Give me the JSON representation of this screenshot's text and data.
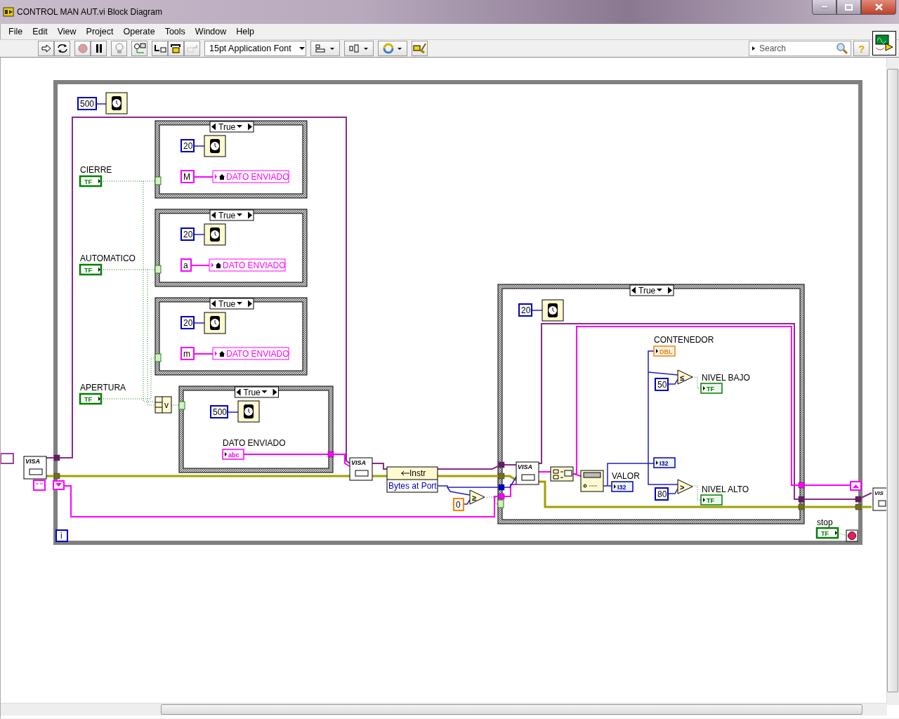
{
  "window": {
    "title": "CONTROL MAN AUT.vi Block Diagram"
  },
  "menu": [
    "File",
    "Edit",
    "View",
    "Project",
    "Operate",
    "Tools",
    "Window",
    "Help"
  ],
  "toolbar": {
    "font": "15pt Application Font",
    "search": {
      "placeholder": "Search"
    },
    "help": "?"
  },
  "nodes": [
    {
      "kind": "constant",
      "text": "500",
      "color": "#0000c0"
    },
    {
      "kind": "case",
      "selector": "True"
    },
    {
      "kind": "constant",
      "text": "20",
      "color": "#0000c0"
    },
    {
      "kind": "label",
      "text": "CIERRE"
    },
    {
      "kind": "control",
      "text": "TF",
      "color": "#008000"
    },
    {
      "kind": "constant",
      "text": "M",
      "color": "#ff00ff"
    },
    {
      "kind": "local",
      "text": "DATO ENVIADO"
    },
    {
      "kind": "case",
      "selector": "True"
    },
    {
      "kind": "constant",
      "text": "20",
      "color": "#0000c0"
    },
    {
      "kind": "label",
      "text": "AUTOMATICO"
    },
    {
      "kind": "control",
      "text": "TF",
      "color": "#008000"
    },
    {
      "kind": "constant",
      "text": "a",
      "color": "#ff00ff"
    },
    {
      "kind": "local",
      "text": "DATO ENVIADO"
    },
    {
      "kind": "case",
      "selector": "True"
    },
    {
      "kind": "constant",
      "text": "20",
      "color": "#0000c0"
    },
    {
      "kind": "constant",
      "text": "m",
      "color": "#ff00ff"
    },
    {
      "kind": "local",
      "text": "DATO ENVIADO"
    },
    {
      "kind": "case",
      "selector": "True"
    },
    {
      "kind": "label",
      "text": "APERTURA"
    },
    {
      "kind": "control",
      "text": "TF",
      "color": "#008000"
    },
    {
      "kind": "function",
      "text": "v"
    },
    {
      "kind": "constant",
      "text": "500",
      "color": "#0000c0"
    },
    {
      "kind": "label",
      "text": "DATO ENVIADO"
    },
    {
      "kind": "indicator",
      "text": "abc",
      "color": "#ff00ff"
    },
    {
      "kind": "vi",
      "text": "VISA"
    },
    {
      "kind": "vi",
      "text": "VISA"
    },
    {
      "kind": "property",
      "rows": [
        "Instr",
        "Bytes at Port"
      ]
    },
    {
      "kind": "constant",
      "text": "0",
      "color": "#ff8000"
    },
    {
      "kind": "compare",
      "text": "≥"
    },
    {
      "kind": "iteration",
      "text": "i"
    },
    {
      "kind": "case",
      "selector": "True"
    },
    {
      "kind": "constant",
      "text": "20",
      "color": "#0000c0"
    },
    {
      "kind": "label",
      "text": "CONTENEDOR"
    },
    {
      "kind": "indicator",
      "text": "DBL",
      "color": "#ff8000"
    },
    {
      "kind": "compare",
      "text": "≤"
    },
    {
      "kind": "label",
      "text": "NIVEL BAJO"
    },
    {
      "kind": "constant",
      "text": "50",
      "color": "#0000c0"
    },
    {
      "kind": "indicator",
      "text": "TF",
      "color": "#008000"
    },
    {
      "kind": "indicator",
      "text": "I32",
      "color": "#0000c0"
    },
    {
      "kind": "vi",
      "text": "VISA"
    },
    {
      "kind": "label",
      "text": "VALOR"
    },
    {
      "kind": "indicator",
      "text": "I32",
      "color": "#0000c0"
    },
    {
      "kind": "compare",
      "text": ">"
    },
    {
      "kind": "label",
      "text": "NIVEL ALTO"
    },
    {
      "kind": "constant",
      "text": "80",
      "color": "#0000c0"
    },
    {
      "kind": "indicator",
      "text": "TF",
      "color": "#008000"
    },
    {
      "kind": "label",
      "text": "stop"
    },
    {
      "kind": "control",
      "text": "TF",
      "color": "#008000"
    },
    {
      "kind": "vi",
      "text": "VIS"
    }
  ]
}
